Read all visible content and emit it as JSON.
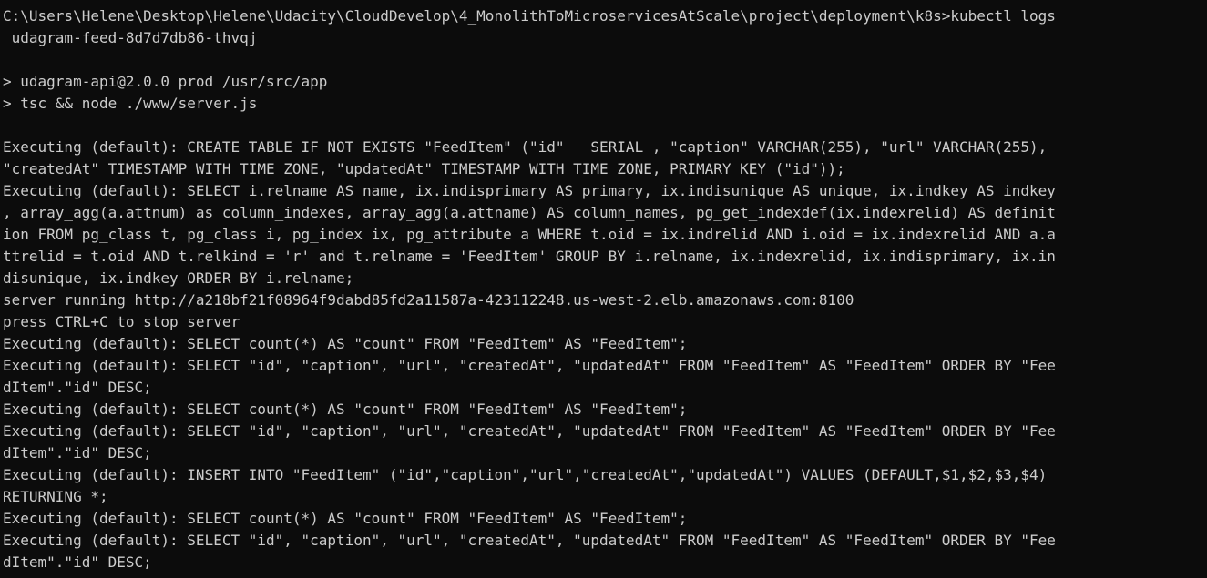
{
  "terminal": {
    "background_color": "#0c0c0c",
    "text_color": "#cccccc",
    "lines": [
      "C:\\Users\\Helene\\Desktop\\Helene\\Udacity\\CloudDevelop\\4_MonolithToMicroservicesAtScale\\project\\deployment\\k8s>kubectl logs",
      " udagram-feed-8d7d7db86-thvqj",
      "",
      "> udagram-api@2.0.0 prod /usr/src/app",
      "> tsc && node ./www/server.js",
      "",
      "Executing (default): CREATE TABLE IF NOT EXISTS \"FeedItem\" (\"id\"   SERIAL , \"caption\" VARCHAR(255), \"url\" VARCHAR(255),",
      "\"createdAt\" TIMESTAMP WITH TIME ZONE, \"updatedAt\" TIMESTAMP WITH TIME ZONE, PRIMARY KEY (\"id\"));",
      "Executing (default): SELECT i.relname AS name, ix.indisprimary AS primary, ix.indisunique AS unique, ix.indkey AS indkey",
      ", array_agg(a.attnum) as column_indexes, array_agg(a.attname) AS column_names, pg_get_indexdef(ix.indexrelid) AS definit",
      "ion FROM pg_class t, pg_class i, pg_index ix, pg_attribute a WHERE t.oid = ix.indrelid AND i.oid = ix.indexrelid AND a.a",
      "ttrelid = t.oid AND t.relkind = 'r' and t.relname = 'FeedItem' GROUP BY i.relname, ix.indexrelid, ix.indisprimary, ix.in",
      "disunique, ix.indkey ORDER BY i.relname;",
      "server running http://a218bf21f08964f9dabd85fd2a11587a-423112248.us-west-2.elb.amazonaws.com:8100",
      "press CTRL+C to stop server",
      "Executing (default): SELECT count(*) AS \"count\" FROM \"FeedItem\" AS \"FeedItem\";",
      "Executing (default): SELECT \"id\", \"caption\", \"url\", \"createdAt\", \"updatedAt\" FROM \"FeedItem\" AS \"FeedItem\" ORDER BY \"Fee",
      "dItem\".\"id\" DESC;",
      "Executing (default): SELECT count(*) AS \"count\" FROM \"FeedItem\" AS \"FeedItem\";",
      "Executing (default): SELECT \"id\", \"caption\", \"url\", \"createdAt\", \"updatedAt\" FROM \"FeedItem\" AS \"FeedItem\" ORDER BY \"Fee",
      "dItem\".\"id\" DESC;",
      "Executing (default): INSERT INTO \"FeedItem\" (\"id\",\"caption\",\"url\",\"createdAt\",\"updatedAt\") VALUES (DEFAULT,$1,$2,$3,$4)",
      "RETURNING *;",
      "Executing (default): SELECT count(*) AS \"count\" FROM \"FeedItem\" AS \"FeedItem\";",
      "Executing (default): SELECT \"id\", \"caption\", \"url\", \"createdAt\", \"updatedAt\" FROM \"FeedItem\" AS \"FeedItem\" ORDER BY \"Fee",
      "dItem\".\"id\" DESC;"
    ]
  }
}
